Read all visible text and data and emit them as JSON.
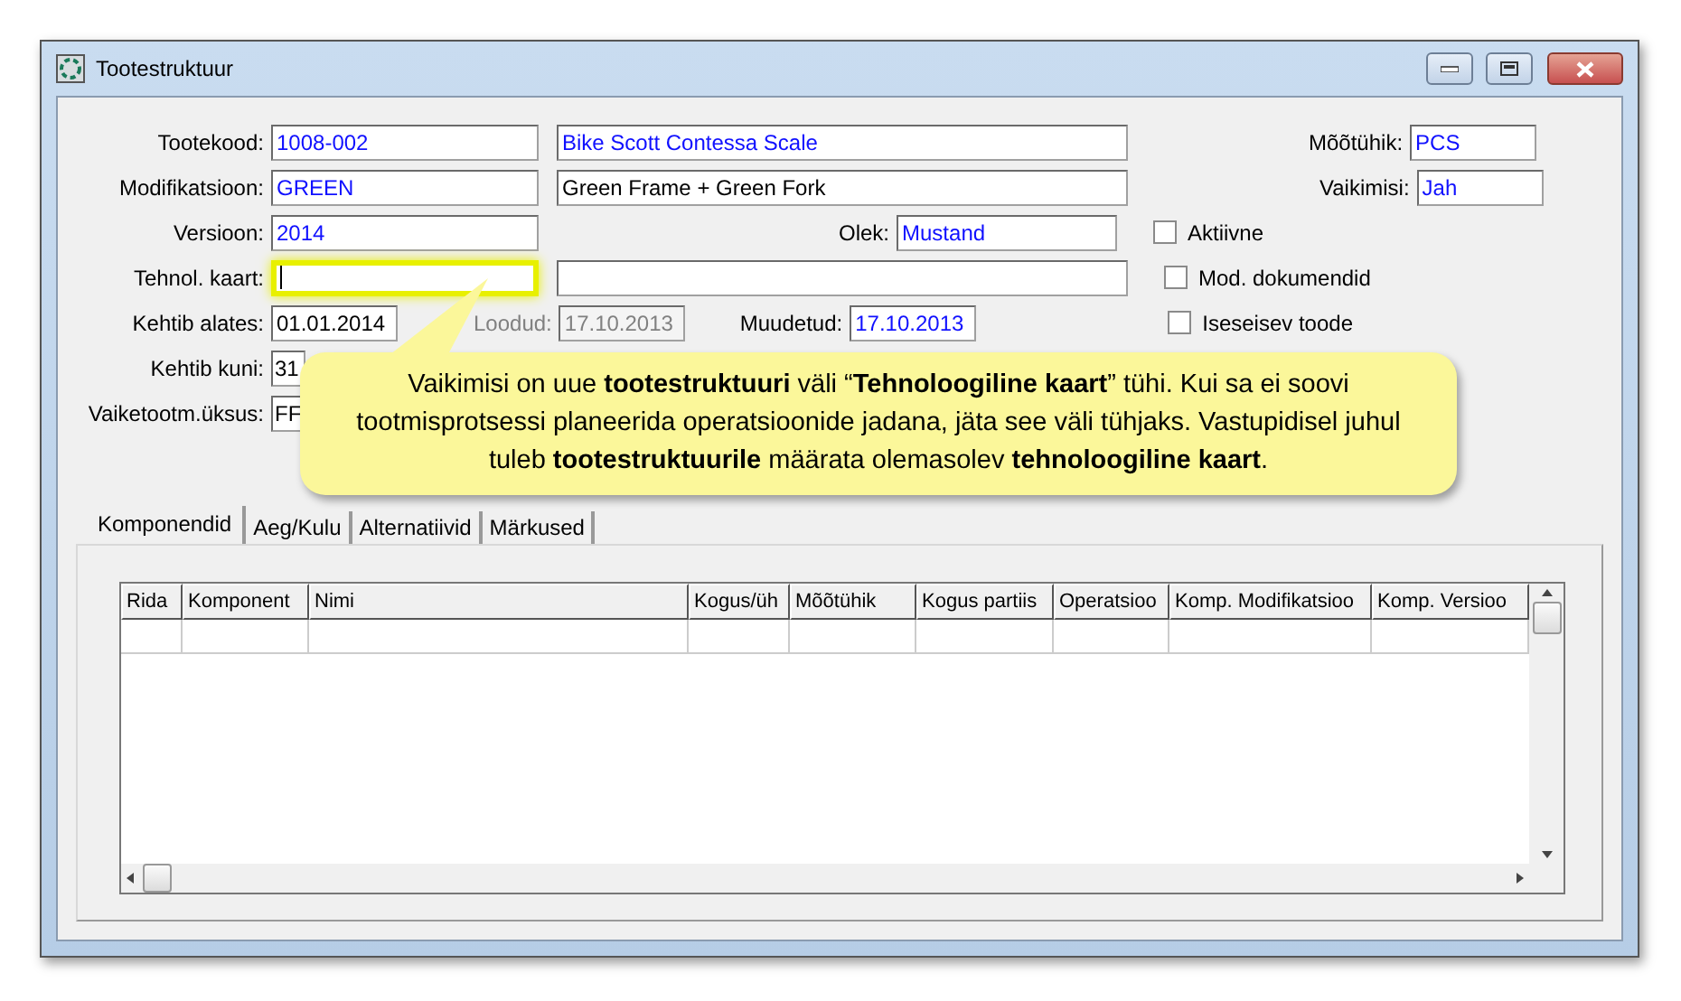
{
  "window": {
    "title": "Tootestruktuur"
  },
  "form": {
    "product_code": {
      "label": "Tootekood:",
      "value": "1008-002",
      "kind": "lookup"
    },
    "product_name": {
      "value": "Bike Scott Contessa Scale",
      "kind": "lookup"
    },
    "modification": {
      "label": "Modifikatsioon:",
      "value": "GREEN",
      "kind": "lookup"
    },
    "modification_name": {
      "value": "Green Frame + Green Fork",
      "kind": "text"
    },
    "version": {
      "label": "Versioon:",
      "value": "2014",
      "kind": "lookup"
    },
    "status": {
      "label": "Olek:",
      "value": "Mustand",
      "kind": "lookup"
    },
    "tech_card": {
      "label": "Tehnol. kaart:",
      "highlighted": true
    },
    "valid_from": {
      "label": "Kehtib alates:",
      "value": "01.01.2014",
      "kind": "text"
    },
    "created": {
      "label": "Loodud:",
      "value": "17.10.2013",
      "kind": "text",
      "disabled": true
    },
    "modified": {
      "label": "Muudetud:",
      "value": "17.10.2013",
      "kind": "lookup"
    },
    "valid_to": {
      "label": "Kehtib kuni:",
      "value": "31",
      "kind": "text"
    },
    "default_unit": {
      "label": "Vaiketootm.üksus:",
      "value": "FF",
      "kind": "text"
    },
    "unit": {
      "label": "Mõõtühik:",
      "value": "PCS",
      "kind": "lookup"
    },
    "default": {
      "label": "Vaikimisi:",
      "value": "Jah",
      "kind": "lookup"
    },
    "checkboxes": [
      {
        "label": "Aktiivne",
        "checked": false
      },
      {
        "label": "Mod. dokumendid",
        "checked": false
      },
      {
        "label": "Iseseisev toode",
        "checked": false
      }
    ]
  },
  "tabs": [
    {
      "label": "Komponendid",
      "selected": true
    },
    {
      "label": "Aeg/Kulu",
      "selected": false
    },
    {
      "label": "Alternatiivid",
      "selected": false
    },
    {
      "label": "Märkused",
      "selected": false
    }
  ],
  "table": {
    "columns": [
      "Rida",
      "Komponent",
      "Nimi",
      "Kogus/üh",
      "Mõõtühik",
      "Kogus partiis",
      "Operatsioo",
      "Komp. Modifikatsioo",
      "Komp. Versioo"
    ]
  },
  "callout": {
    "text": "Vaikimisi on uue **tootestruktuuri** väli “**Tehnoloogiline kaart**” tühi. Kui sa ei soovi tootmisprotsessi planeerida operatsioonide jadana, jäta see väli tühjaks. Vastupidisel juhul tuleb **tootestruktuurile** määrata olemasolev **tehnoloogiline kaart**."
  }
}
